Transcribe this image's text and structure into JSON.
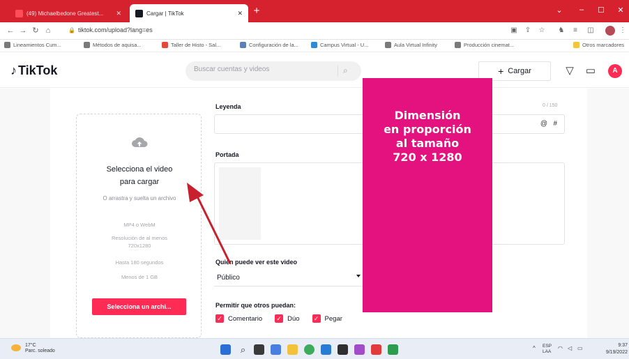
{
  "browser": {
    "tabs": [
      {
        "label": "(49) Michaelbedone Greatest...",
        "active": false
      },
      {
        "label": "Cargar | TikTok",
        "active": true
      }
    ],
    "url": "tiktok.com/upload?lang=es",
    "bookmarks": [
      "Lineamientos Cum...",
      "Métodos de aquisa...",
      "Taller de Histo - Sal...",
      "Configuración de la...",
      "Campus Virtual - U...",
      "Aula Virtual Infinity",
      "Producción cinemat...",
      "Otros marcadores"
    ],
    "colors": {
      "tabstrip": "#d6222f"
    }
  },
  "header": {
    "logo": "TikTok",
    "search_placeholder": "Buscar cuentas y videos",
    "upload_label": "Cargar",
    "avatar_initial": "A"
  },
  "upload": {
    "title": "Selecciona el video para cargar",
    "subtitle": "O arrastra y suelta un archivo",
    "format": "MP4 o WebM",
    "resolution_line1": "Resolución de al menos",
    "resolution_line2": "720x1280",
    "duration": "Hasta 180 segundos",
    "size": "Menos de 1 GB",
    "button": "Selecciona un archi..."
  },
  "form": {
    "caption_label": "Leyenda",
    "caption_counter": "0 / 150",
    "at_symbol": "@",
    "hash_symbol": "#",
    "cover_label": "Portada",
    "privacy_label": "Quién puede ver este video",
    "privacy_value": "Público",
    "allow_label": "Permitir que otros puedan:",
    "checks": [
      "Comentario",
      "Dúo",
      "Pegar"
    ]
  },
  "annotation": {
    "text": "Dimensión\nen proporción\nal tamaño\n720 x 1280",
    "color": "#e4127e"
  },
  "taskbar": {
    "temperature": "17°C",
    "weather": "Parc. soleado",
    "lang_line1": "ESP",
    "lang_line2": "LAA",
    "time": "9:37",
    "date": "9/19/2022"
  }
}
